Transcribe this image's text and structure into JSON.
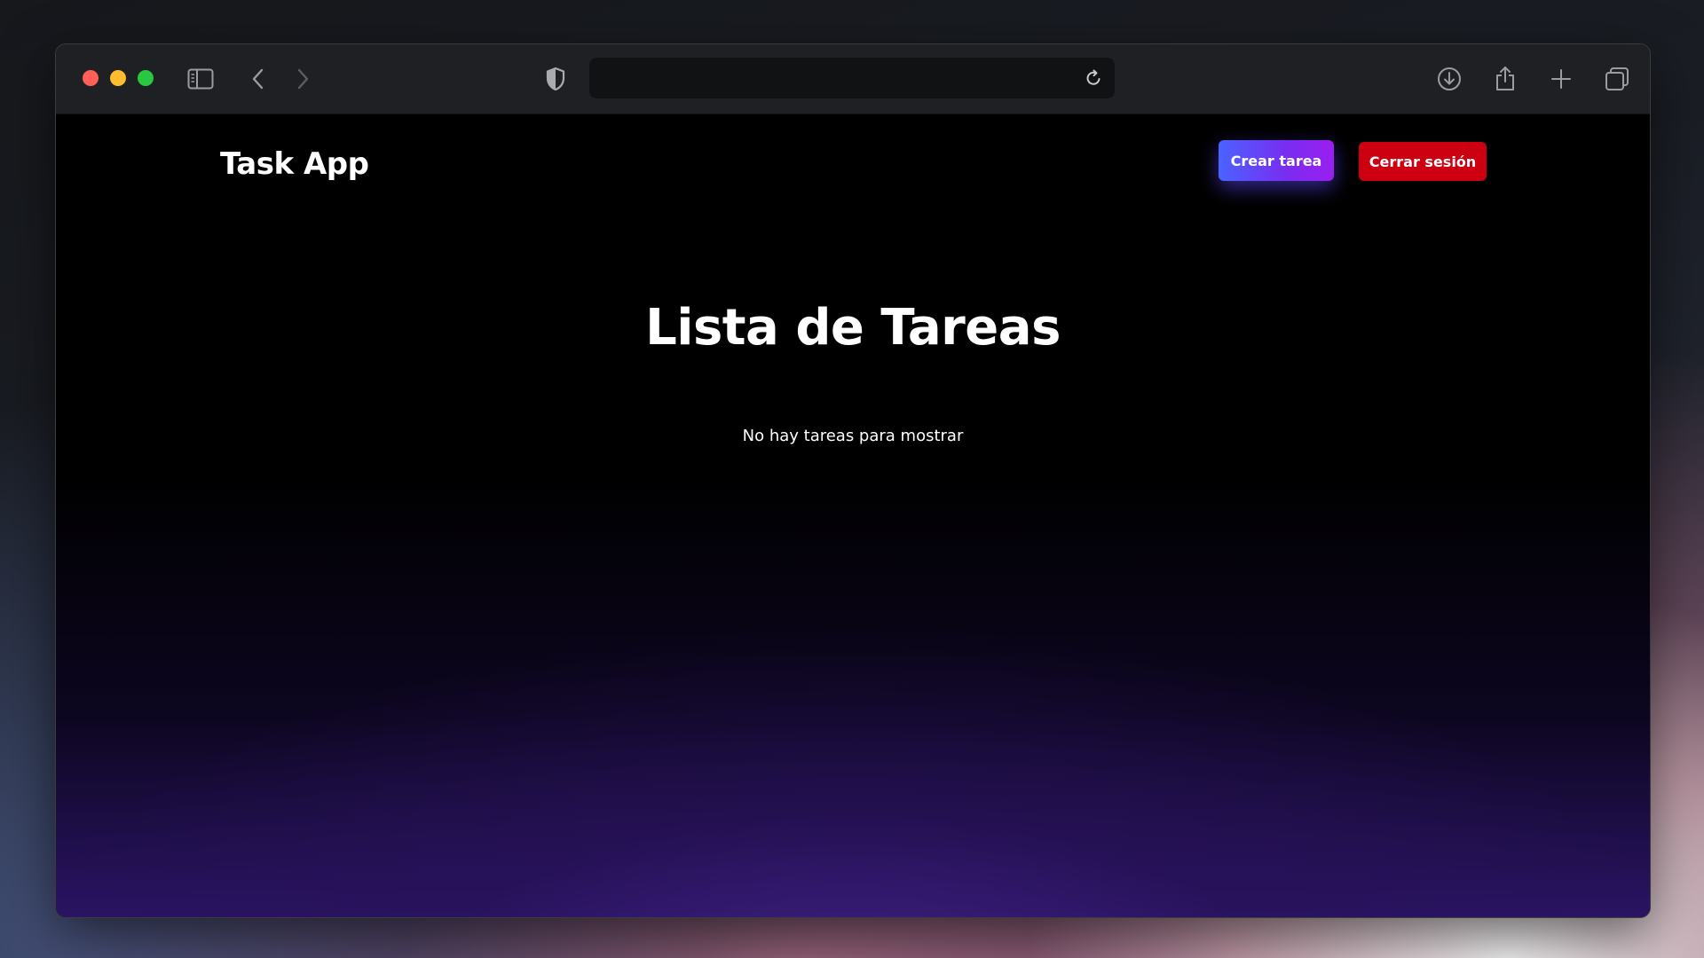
{
  "browser": {
    "address_value": "",
    "icons": {
      "sidebar": "sidebar-icon",
      "back": "chevron-left-icon",
      "forward": "chevron-right-icon",
      "privacy": "shield-icon",
      "reload": "reload-icon",
      "download": "download-icon",
      "share": "share-icon",
      "new_tab": "plus-icon",
      "tabs": "tab-overview-icon"
    }
  },
  "app": {
    "brand": "Task App",
    "create_label": "Crear tarea",
    "logout_label": "Cerrar sesión",
    "title": "Lista de Tareas",
    "empty_message": "No hay tareas para mostrar"
  },
  "colors": {
    "create_gradient_start": "#4a63ff",
    "create_gradient_end": "#9a1ff0",
    "logout": "#cc0010",
    "page_background": "#000000",
    "glow": "#2a1464"
  }
}
